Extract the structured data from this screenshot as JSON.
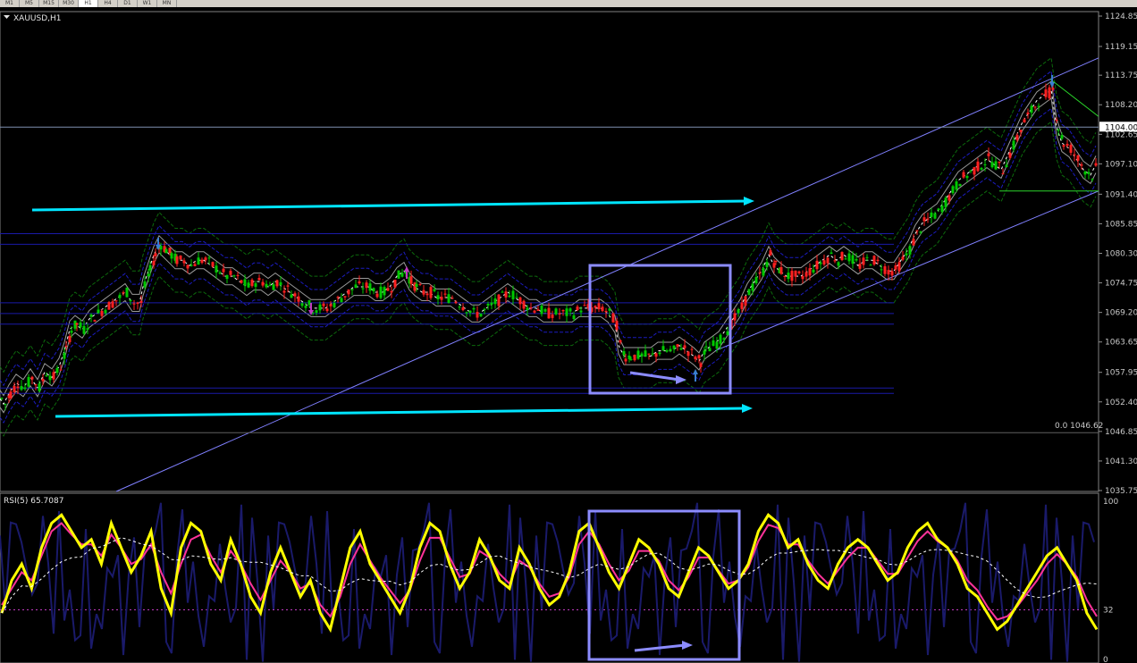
{
  "toolbar": {
    "timeframes": [
      "M1",
      "M5",
      "M15",
      "M30",
      "H1",
      "H4",
      "D1",
      "W1",
      "MN"
    ],
    "active": "H1"
  },
  "chart_data": [
    {
      "type": "candlestick",
      "symbol_label": "XAUUSD,H1",
      "ylim": [
        1035.75,
        1124.85
      ],
      "y_ticks": [
        "1124.85",
        "1119.15",
        "1113.75",
        "1108.20",
        "1102.65",
        "1097.10",
        "1091.40",
        "1085.85",
        "1080.30",
        "1074.75",
        "1069.20",
        "1063.65",
        "1057.95",
        "1052.40",
        "1046.85",
        "1041.30",
        "1035.75"
      ],
      "current_price_label": "1104.00",
      "hline_label": "0.0 1046.62",
      "hline_value": 1046.62,
      "colors": {
        "bull": "#00c800",
        "bear": "#ff2020",
        "bands_blue": "#2a2ad8",
        "bands_green": "#0a7a0a",
        "annotation": "#00e5ff",
        "box": "#8c8cff"
      },
      "price_path": [
        [
          0,
          1053
        ],
        [
          4,
          1052
        ],
        [
          10,
          1054
        ],
        [
          18,
          1056
        ],
        [
          26,
          1055
        ],
        [
          34,
          1057
        ],
        [
          42,
          1055
        ],
        [
          50,
          1058
        ],
        [
          58,
          1057
        ],
        [
          66,
          1059
        ],
        [
          72,
          1062
        ],
        [
          78,
          1066
        ],
        [
          84,
          1067
        ],
        [
          92,
          1066
        ],
        [
          100,
          1068
        ],
        [
          108,
          1069
        ],
        [
          116,
          1070
        ],
        [
          124,
          1071
        ],
        [
          132,
          1072
        ],
        [
          140,
          1073
        ],
        [
          148,
          1071
        ],
        [
          156,
          1071
        ],
        [
          160,
          1074
        ],
        [
          166,
          1077
        ],
        [
          172,
          1080
        ],
        [
          178,
          1082
        ],
        [
          184,
          1081
        ],
        [
          190,
          1080
        ],
        [
          196,
          1079
        ],
        [
          204,
          1079
        ],
        [
          212,
          1078
        ],
        [
          220,
          1079
        ],
        [
          228,
          1079
        ],
        [
          236,
          1078
        ],
        [
          244,
          1077
        ],
        [
          252,
          1076
        ],
        [
          260,
          1076
        ],
        [
          268,
          1075
        ],
        [
          276,
          1074
        ],
        [
          284,
          1075
        ],
        [
          292,
          1075
        ],
        [
          300,
          1074
        ],
        [
          308,
          1075
        ],
        [
          316,
          1074
        ],
        [
          324,
          1073
        ],
        [
          332,
          1072
        ],
        [
          340,
          1071
        ],
        [
          348,
          1070
        ],
        [
          356,
          1070
        ],
        [
          364,
          1070
        ],
        [
          372,
          1071
        ],
        [
          380,
          1072
        ],
        [
          388,
          1073
        ],
        [
          396,
          1074
        ],
        [
          404,
          1074
        ],
        [
          412,
          1074
        ],
        [
          420,
          1073
        ],
        [
          428,
          1073
        ],
        [
          436,
          1074
        ],
        [
          444,
          1076
        ],
        [
          452,
          1077
        ],
        [
          458,
          1075
        ],
        [
          464,
          1074
        ],
        [
          472,
          1073
        ],
        [
          480,
          1073
        ],
        [
          488,
          1072
        ],
        [
          496,
          1072
        ],
        [
          504,
          1072
        ],
        [
          512,
          1071
        ],
        [
          520,
          1070
        ],
        [
          528,
          1069
        ],
        [
          536,
          1069
        ],
        [
          544,
          1070
        ],
        [
          552,
          1071
        ],
        [
          560,
          1072
        ],
        [
          568,
          1073
        ],
        [
          576,
          1072
        ],
        [
          584,
          1071
        ],
        [
          592,
          1070
        ],
        [
          600,
          1070
        ],
        [
          608,
          1069
        ],
        [
          616,
          1069
        ],
        [
          624,
          1069
        ],
        [
          632,
          1069
        ],
        [
          640,
          1069
        ],
        [
          648,
          1070
        ],
        [
          656,
          1070
        ],
        [
          664,
          1070
        ],
        [
          672,
          1070
        ],
        [
          680,
          1069
        ],
        [
          688,
          1067
        ],
        [
          692,
          1063
        ],
        [
          698,
          1061
        ],
        [
          704,
          1061
        ],
        [
          712,
          1061
        ],
        [
          720,
          1061
        ],
        [
          728,
          1061
        ],
        [
          736,
          1062
        ],
        [
          744,
          1062
        ],
        [
          752,
          1062
        ],
        [
          760,
          1063
        ],
        [
          768,
          1062
        ],
        [
          776,
          1061
        ],
        [
          782,
          1060
        ],
        [
          788,
          1062
        ],
        [
          796,
          1063
        ],
        [
          804,
          1064
        ],
        [
          812,
          1066
        ],
        [
          820,
          1068
        ],
        [
          828,
          1070
        ],
        [
          836,
          1073
        ],
        [
          844,
          1075
        ],
        [
          852,
          1077
        ],
        [
          860,
          1080
        ],
        [
          866,
          1078
        ],
        [
          872,
          1077
        ],
        [
          880,
          1076
        ],
        [
          888,
          1076
        ],
        [
          896,
          1076
        ],
        [
          904,
          1077
        ],
        [
          912,
          1078
        ],
        [
          920,
          1079
        ],
        [
          928,
          1080
        ],
        [
          936,
          1079
        ],
        [
          944,
          1080
        ],
        [
          952,
          1079
        ],
        [
          960,
          1078
        ],
        [
          968,
          1079
        ],
        [
          976,
          1079
        ],
        [
          984,
          1078
        ],
        [
          992,
          1077
        ],
        [
          1000,
          1077
        ],
        [
          1008,
          1079
        ],
        [
          1016,
          1081
        ],
        [
          1024,
          1084
        ],
        [
          1032,
          1086
        ],
        [
          1040,
          1087
        ],
        [
          1048,
          1088
        ],
        [
          1056,
          1090
        ],
        [
          1064,
          1092
        ],
        [
          1072,
          1094
        ],
        [
          1080,
          1095
        ],
        [
          1088,
          1096
        ],
        [
          1096,
          1097
        ],
        [
          1104,
          1098
        ],
        [
          1112,
          1097
        ],
        [
          1120,
          1096
        ],
        [
          1128,
          1099
        ],
        [
          1136,
          1102
        ],
        [
          1144,
          1105
        ],
        [
          1152,
          1107
        ],
        [
          1160,
          1109
        ],
        [
          1168,
          1110
        ],
        [
          1176,
          1111
        ],
        [
          1182,
          1104
        ],
        [
          1188,
          1101
        ],
        [
          1196,
          1100
        ],
        [
          1204,
          1098
        ],
        [
          1212,
          1096
        ],
        [
          1220,
          1095
        ],
        [
          1226,
          1097
        ]
      ]
    },
    {
      "type": "line",
      "label": "RSI(5) 65.7087",
      "ylim": [
        0,
        100
      ],
      "y_ticks": [
        "100",
        "32",
        "0"
      ],
      "level": 32,
      "series": [
        {
          "color": "#ffff00",
          "values": [
            30,
            50,
            60,
            45,
            70,
            85,
            90,
            80,
            70,
            75,
            60,
            85,
            70,
            55,
            65,
            80,
            45,
            30,
            70,
            85,
            80,
            60,
            50,
            75,
            60,
            40,
            30,
            55,
            70,
            55,
            40,
            50,
            30,
            20,
            45,
            70,
            80,
            60,
            50,
            40,
            30,
            45,
            70,
            85,
            80,
            60,
            45,
            55,
            75,
            65,
            50,
            45,
            70,
            60,
            45,
            35,
            40,
            55,
            80,
            85,
            70,
            55,
            45,
            60,
            75,
            70,
            60,
            45,
            40,
            55,
            70,
            65,
            55,
            45,
            50,
            60,
            80,
            90,
            85,
            70,
            75,
            60,
            50,
            45,
            60,
            70,
            75,
            70,
            60,
            50,
            55,
            70,
            80,
            85,
            75,
            70,
            60,
            45,
            40,
            30,
            20,
            25,
            35,
            45,
            55,
            65,
            70,
            60,
            50,
            30,
            20
          ]
        },
        {
          "color": "#ff3399",
          "values": [
            35,
            45,
            55,
            50,
            65,
            80,
            85,
            78,
            72,
            72,
            65,
            78,
            70,
            60,
            63,
            72,
            55,
            42,
            60,
            75,
            78,
            65,
            55,
            68,
            60,
            48,
            38,
            50,
            62,
            55,
            45,
            48,
            35,
            28,
            40,
            60,
            72,
            62,
            52,
            44,
            36,
            44,
            62,
            76,
            76,
            64,
            52,
            54,
            68,
            64,
            54,
            48,
            62,
            58,
            48,
            40,
            42,
            52,
            72,
            80,
            72,
            60,
            50,
            56,
            68,
            68,
            62,
            50,
            44,
            52,
            64,
            64,
            56,
            48,
            50,
            58,
            74,
            84,
            82,
            72,
            72,
            62,
            54,
            48,
            56,
            64,
            70,
            70,
            62,
            54,
            54,
            64,
            74,
            80,
            74,
            70,
            62,
            50,
            44,
            34,
            26,
            28,
            34,
            42,
            50,
            60,
            66,
            60,
            52,
            38,
            28
          ]
        }
      ]
    }
  ],
  "annotations": {
    "arrow_upper": "cyan-arrow-right",
    "arrow_lower": "cyan-arrow-right",
    "arrow_box": "lavender-arrow-right",
    "arrow_rsi": "lavender-arrow-right",
    "marker_icons": [
      "down-arrow-icon",
      "up-arrow-icon"
    ]
  }
}
